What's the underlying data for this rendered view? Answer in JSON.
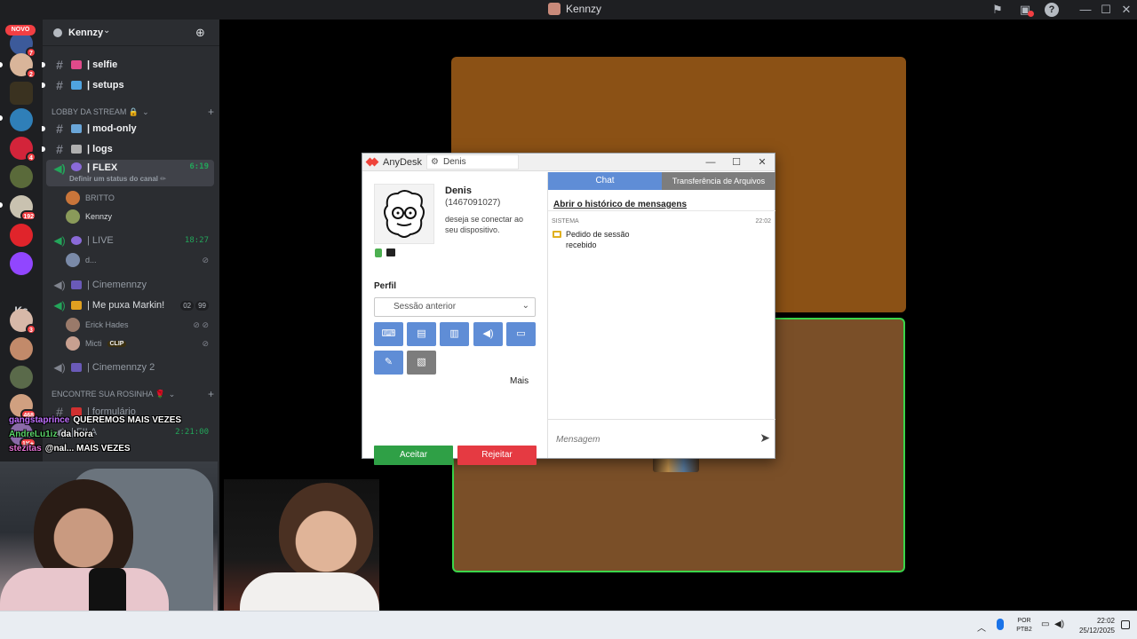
{
  "window": {
    "title": "Kennzy"
  },
  "rail": {
    "novo_label": "NOVO",
    "ks_label": "Ks",
    "badges": [
      "7",
      "2",
      "4",
      "192",
      "3",
      "468",
      "1K+"
    ]
  },
  "sidebar": {
    "guild_name": "Kennzy",
    "channels": [
      {
        "label": "| selfie"
      },
      {
        "label": "| setups"
      }
    ],
    "category_lobby": "LOBBY DA STREAM 🔒",
    "lobby_channels": [
      {
        "label": "| mod-only"
      },
      {
        "label": "| logs"
      }
    ],
    "voice_flex": {
      "label": "| FLEX",
      "time": "6:19",
      "status": "Definir um status do canal ✏"
    },
    "flex_users": [
      "BRITTO",
      "Kennzy"
    ],
    "voice_live": {
      "label": "| LIVE",
      "time": "18:27"
    },
    "live_users": [
      "d..."
    ],
    "voice_cinema": {
      "label": "| Cinemennzy"
    },
    "voice_markin": {
      "label": "| Me puxa Markin!",
      "count_a": "02",
      "count_b": "99"
    },
    "markin_users": [
      "Erick Hades",
      "Micti"
    ],
    "clip_label": "CLIP",
    "voice_cinema2": {
      "label": "| Cinemennzy 2"
    },
    "category_rosinha": "ENCONTRE SUA ROSINHA 🌹",
    "rosinha_channels": [
      {
        "label": "| formulário"
      }
    ],
    "fila": {
      "label": "| FILA",
      "time": "2:21:00"
    }
  },
  "stream_chat": [
    {
      "user": "gangstaprince",
      "msg": "QUEREMOS MAIS VEZES"
    },
    {
      "user": "AndreLu1iz",
      "msg": "da hora"
    },
    {
      "user": "stezitas",
      "msg": "@nal... MAIS VEZES"
    }
  ],
  "anydesk": {
    "app_name": "AnyDesk",
    "tab_name": "Denis",
    "requester_name": "Denis",
    "requester_id": "(1467091027)",
    "request_text": "deseja se conectar ao seu dispositivo.",
    "profile_label": "Perfil",
    "profile_value": "Sessão anterior",
    "more_label": "Mais",
    "accept_label": "Aceitar",
    "reject_label": "Rejeitar",
    "chat_tab": "Chat",
    "files_tab": "Transferência de Arquivos",
    "history_link": "Abrir o histórico de mensagens",
    "system_label": "SISTEMA",
    "message_time": "22:02",
    "message_text": "Pedido de sessão recebido",
    "input_placeholder": "Mensagem",
    "colors": {
      "accent_blue": "#5f8dd6",
      "accept_green": "#2fa046",
      "reject_red": "#e53a42"
    }
  },
  "taskbar": {
    "lang_top": "POR",
    "lang_bottom": "PTB2",
    "time": "22:02",
    "date": "25/12/2025"
  }
}
